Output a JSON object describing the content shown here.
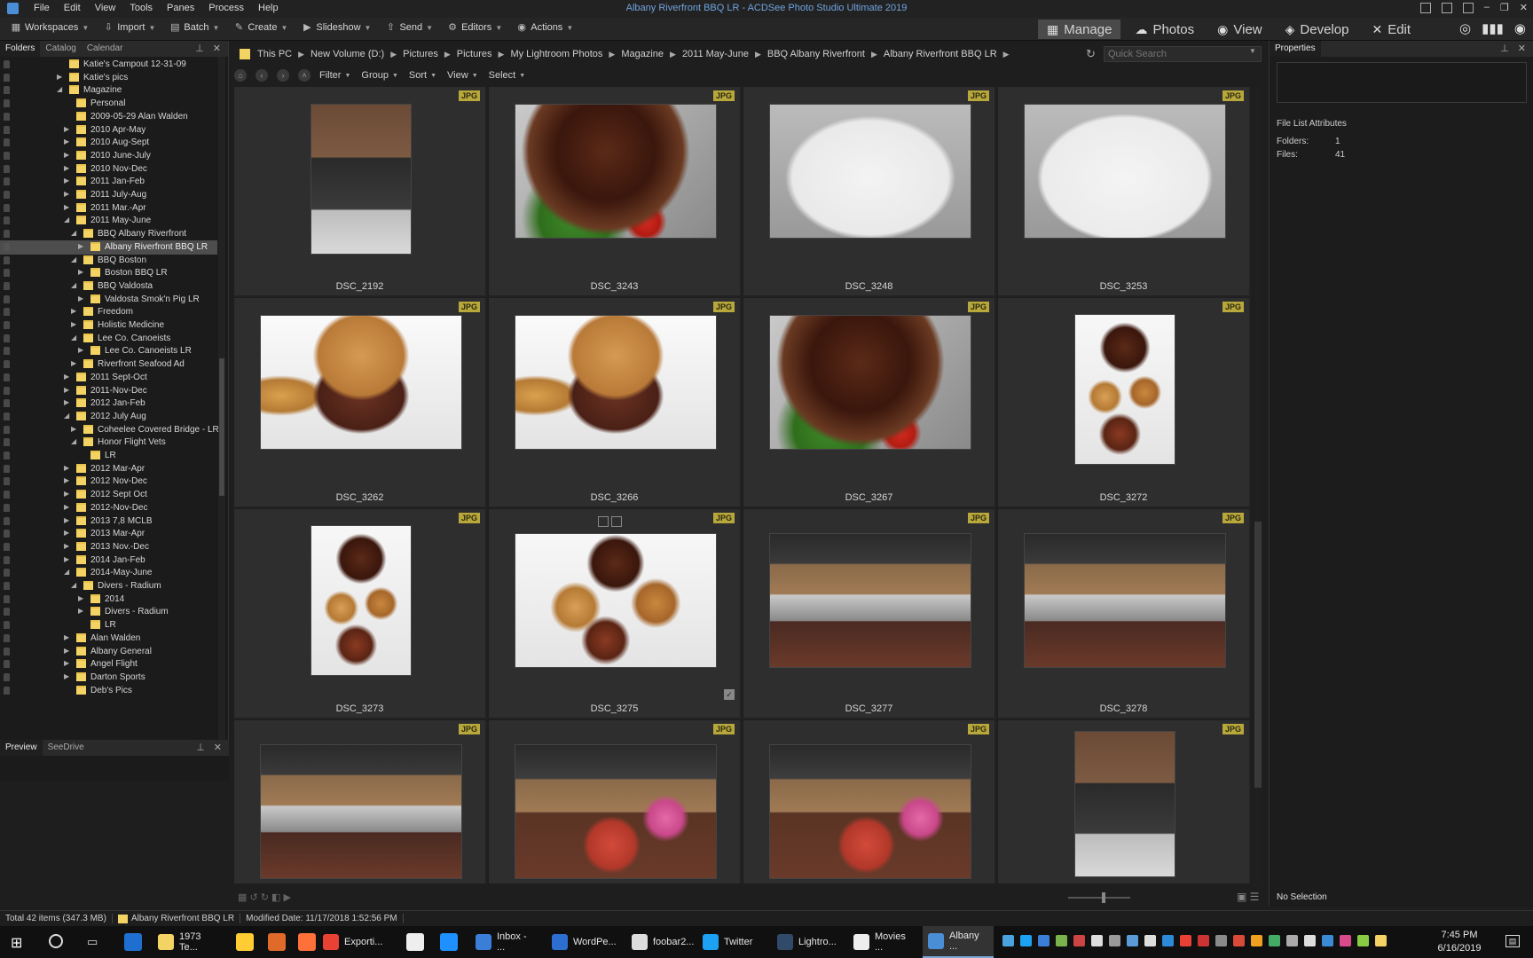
{
  "app": {
    "window_title": "Albany Riverfront BBQ LR - ACDSee Photo Studio Ultimate 2019",
    "menu": [
      "File",
      "Edit",
      "View",
      "Tools",
      "Panes",
      "Process",
      "Help"
    ]
  },
  "toolbar": {
    "tools": [
      {
        "label": "Workspaces",
        "icon": "workspaces-icon"
      },
      {
        "label": "Import",
        "icon": "import-icon"
      },
      {
        "label": "Batch",
        "icon": "batch-icon"
      },
      {
        "label": "Create",
        "icon": "create-icon"
      },
      {
        "label": "Slideshow",
        "icon": "slideshow-icon"
      },
      {
        "label": "Send",
        "icon": "send-icon"
      },
      {
        "label": "Editors",
        "icon": "editors-icon"
      },
      {
        "label": "Actions",
        "icon": "actions-icon"
      }
    ],
    "modes": [
      {
        "label": "Manage",
        "active": true
      },
      {
        "label": "Photos",
        "active": false
      },
      {
        "label": "View",
        "active": false
      },
      {
        "label": "Develop",
        "active": false
      },
      {
        "label": "Edit",
        "active": false
      }
    ]
  },
  "left_panel": {
    "tabs": [
      "Folders",
      "Catalog",
      "Calendar"
    ],
    "active_tab": "Folders",
    "tree": [
      {
        "label": "Katie's Campout 12-31-09",
        "depth": 1,
        "toggle": "",
        "selected": false
      },
      {
        "label": "Katie's pics",
        "depth": 1,
        "toggle": "▶",
        "selected": false
      },
      {
        "label": "Magazine",
        "depth": 1,
        "toggle": "◢",
        "selected": false
      },
      {
        "label": "Personal",
        "depth": 2,
        "toggle": "",
        "selected": false
      },
      {
        "label": "2009-05-29 Alan Walden",
        "depth": 2,
        "toggle": "",
        "selected": false
      },
      {
        "label": "2010 Apr-May",
        "depth": 2,
        "toggle": "▶",
        "selected": false
      },
      {
        "label": "2010 Aug-Sept",
        "depth": 2,
        "toggle": "▶",
        "selected": false
      },
      {
        "label": "2010 June-July",
        "depth": 2,
        "toggle": "▶",
        "selected": false
      },
      {
        "label": "2010 Nov-Dec",
        "depth": 2,
        "toggle": "▶",
        "selected": false
      },
      {
        "label": "2011 Jan-Feb",
        "depth": 2,
        "toggle": "▶",
        "selected": false
      },
      {
        "label": "2011 July-Aug",
        "depth": 2,
        "toggle": "▶",
        "selected": false
      },
      {
        "label": "2011 Mar.-Apr",
        "depth": 2,
        "toggle": "▶",
        "selected": false
      },
      {
        "label": "2011 May-June",
        "depth": 2,
        "toggle": "◢",
        "selected": false
      },
      {
        "label": "BBQ Albany Riverfront",
        "depth": 3,
        "toggle": "◢",
        "selected": false
      },
      {
        "label": "Albany Riverfront BBQ LR",
        "depth": 4,
        "toggle": "▶",
        "selected": true
      },
      {
        "label": "BBQ Boston",
        "depth": 3,
        "toggle": "◢",
        "selected": false
      },
      {
        "label": "Boston BBQ LR",
        "depth": 4,
        "toggle": "▶",
        "selected": false
      },
      {
        "label": "BBQ Valdosta",
        "depth": 3,
        "toggle": "◢",
        "selected": false
      },
      {
        "label": "Valdosta Smok'n Pig LR",
        "depth": 4,
        "toggle": "▶",
        "selected": false
      },
      {
        "label": "Freedom",
        "depth": 3,
        "toggle": "▶",
        "selected": false
      },
      {
        "label": "Holistic Medicine",
        "depth": 3,
        "toggle": "▶",
        "selected": false
      },
      {
        "label": "Lee Co. Canoeists",
        "depth": 3,
        "toggle": "◢",
        "selected": false
      },
      {
        "label": "Lee Co. Canoeists LR",
        "depth": 4,
        "toggle": "▶",
        "selected": false
      },
      {
        "label": "Riverfront Seafood Ad",
        "depth": 3,
        "toggle": "▶",
        "selected": false
      },
      {
        "label": "2011 Sept-Oct",
        "depth": 2,
        "toggle": "▶",
        "selected": false
      },
      {
        "label": "2011-Nov-Dec",
        "depth": 2,
        "toggle": "▶",
        "selected": false
      },
      {
        "label": "2012 Jan-Feb",
        "depth": 2,
        "toggle": "▶",
        "selected": false
      },
      {
        "label": "2012 July Aug",
        "depth": 2,
        "toggle": "◢",
        "selected": false
      },
      {
        "label": "Coheelee Covered Bridge - LR",
        "depth": 3,
        "toggle": "▶",
        "selected": false
      },
      {
        "label": "Honor Flight Vets",
        "depth": 3,
        "toggle": "◢",
        "selected": false
      },
      {
        "label": "LR",
        "depth": 4,
        "toggle": "",
        "selected": false
      },
      {
        "label": "2012 Mar-Apr",
        "depth": 2,
        "toggle": "▶",
        "selected": false
      },
      {
        "label": "2012 Nov-Dec",
        "depth": 2,
        "toggle": "▶",
        "selected": false
      },
      {
        "label": "2012 Sept Oct",
        "depth": 2,
        "toggle": "▶",
        "selected": false
      },
      {
        "label": "2012-Nov-Dec",
        "depth": 2,
        "toggle": "▶",
        "selected": false
      },
      {
        "label": "2013 7,8 MCLB",
        "depth": 2,
        "toggle": "▶",
        "selected": false
      },
      {
        "label": "2013 Mar-Apr",
        "depth": 2,
        "toggle": "▶",
        "selected": false
      },
      {
        "label": "2013 Nov.-Dec",
        "depth": 2,
        "toggle": "▶",
        "selected": false
      },
      {
        "label": "2014 Jan-Feb",
        "depth": 2,
        "toggle": "▶",
        "selected": false
      },
      {
        "label": "2014-May-June",
        "depth": 2,
        "toggle": "◢",
        "selected": false
      },
      {
        "label": "Divers - Radium",
        "depth": 3,
        "toggle": "◢",
        "selected": false
      },
      {
        "label": "2014",
        "depth": 4,
        "toggle": "▶",
        "selected": false
      },
      {
        "label": "Divers - Radium",
        "depth": 4,
        "toggle": "▶",
        "selected": false
      },
      {
        "label": "LR",
        "depth": 4,
        "toggle": "",
        "selected": false
      },
      {
        "label": "Alan Walden",
        "depth": 2,
        "toggle": "▶",
        "selected": false
      },
      {
        "label": "Albany General",
        "depth": 2,
        "toggle": "▶",
        "selected": false
      },
      {
        "label": "Angel Flight",
        "depth": 2,
        "toggle": "▶",
        "selected": false
      },
      {
        "label": "Darton Sports",
        "depth": 2,
        "toggle": "▶",
        "selected": false
      },
      {
        "label": "Deb's Pics",
        "depth": 2,
        "toggle": "",
        "selected": false
      }
    ],
    "preview_tabs": [
      "Preview",
      "SeeDrive"
    ]
  },
  "breadcrumb": [
    "This PC",
    "New Volume (D:)",
    "Pictures",
    "Pictures",
    "My Lightroom Photos",
    "Magazine",
    "2011 May-June",
    "BBQ Albany Riverfront",
    "Albany Riverfront BBQ LR"
  ],
  "search": {
    "placeholder": "Quick Search"
  },
  "filters": [
    "Filter",
    "Group",
    "Sort",
    "View",
    "Select"
  ],
  "grid": {
    "badge": "JPG",
    "items": [
      {
        "name": "DSC_2192",
        "orientation": "portrait",
        "scene": "storefront"
      },
      {
        "name": "DSC_3243",
        "orientation": "landscape",
        "scene": "ribs-closeup"
      },
      {
        "name": "DSC_3248",
        "orientation": "landscape",
        "scene": "plate-fries"
      },
      {
        "name": "DSC_3253",
        "orientation": "landscape",
        "scene": "plate-mac"
      },
      {
        "name": "DSC_3262",
        "orientation": "landscape",
        "scene": "sandwich"
      },
      {
        "name": "DSC_3266",
        "orientation": "landscape",
        "scene": "sandwich"
      },
      {
        "name": "DSC_3267",
        "orientation": "landscape",
        "scene": "ribs-closeup"
      },
      {
        "name": "DSC_3272",
        "orientation": "portrait",
        "scene": "spread"
      },
      {
        "name": "DSC_3273",
        "orientation": "portrait",
        "scene": "spread"
      },
      {
        "name": "DSC_3275",
        "orientation": "landscape",
        "scene": "spread",
        "checked": true
      },
      {
        "name": "DSC_3277",
        "orientation": "landscape",
        "scene": "kitchen"
      },
      {
        "name": "DSC_3278",
        "orientation": "landscape",
        "scene": "kitchen"
      },
      {
        "name": "",
        "orientation": "landscape",
        "scene": "kitchen"
      },
      {
        "name": "",
        "orientation": "landscape",
        "scene": "counter"
      },
      {
        "name": "",
        "orientation": "landscape",
        "scene": "counter"
      },
      {
        "name": "",
        "orientation": "portrait",
        "scene": "storefront"
      }
    ]
  },
  "right_panel": {
    "title": "Properties",
    "section": "File List Attributes",
    "attributes": [
      {
        "label": "Folders:",
        "value": "1"
      },
      {
        "label": "Files:",
        "value": "41"
      }
    ],
    "no_selection": "No Selection"
  },
  "status": {
    "total": "Total 42 items  (347.3 MB)",
    "folder": "Albany Riverfront BBQ LR",
    "modified": "Modified Date: 11/17/2018 1:52:56 PM"
  },
  "taskbar": {
    "apps": [
      {
        "label": "1973 Te...",
        "color": "#f4d365",
        "active": false
      },
      {
        "label": "Exporti...",
        "color": "#e94235",
        "active": false
      },
      {
        "label": "Inbox - ...",
        "color": "#3b7ed8",
        "active": false
      },
      {
        "label": "WordPe...",
        "color": "#2c6fd1",
        "active": false
      },
      {
        "label": "foobar2...",
        "color": "#dddddd",
        "active": false
      },
      {
        "label": "Twitter",
        "color": "#1da1f2",
        "active": false
      },
      {
        "label": "Lightro...",
        "color": "#324a6a",
        "active": false
      },
      {
        "label": "Movies ...",
        "color": "#eeeeee",
        "active": false
      },
      {
        "label": "Albany ...",
        "color": "#4a8fd6",
        "active": true
      }
    ],
    "time": "7:45 PM",
    "date": "6/16/2019"
  }
}
